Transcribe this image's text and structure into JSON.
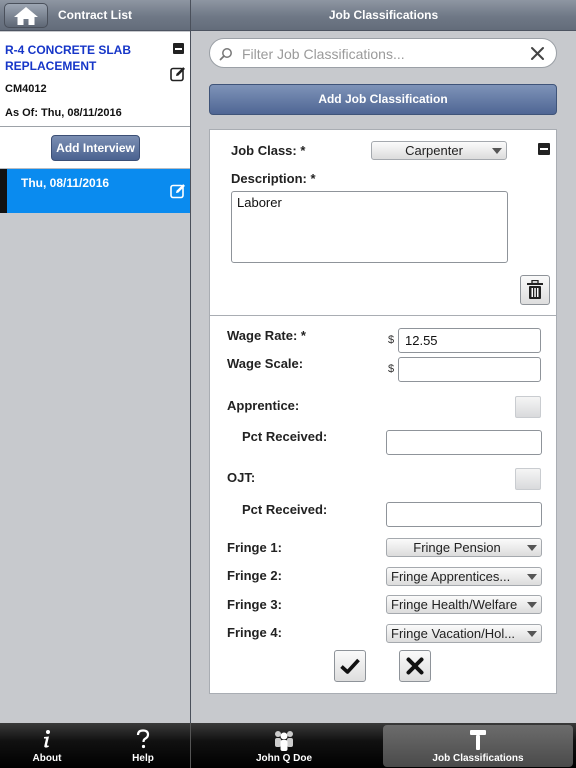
{
  "left_header": {
    "title": "Contract List"
  },
  "right_header": {
    "title": "Job Classifications"
  },
  "contract": {
    "title": "R-4 CONCRETE SLAB REPLACEMENT",
    "number": "CM4012",
    "as_of": "As Of: Thu, 08/11/2016"
  },
  "interview": {
    "add_label": "Add Interview",
    "selected_date": "Thu, 08/11/2016"
  },
  "filter": {
    "placeholder": "Filter Job Classifications..."
  },
  "add_job_label": "Add Job Classification",
  "form": {
    "job_class_label": "Job Class: *",
    "job_class_value": "Carpenter",
    "description_label": "Description: *",
    "description_value": "Laborer",
    "wage_rate_label": "Wage Rate: *",
    "wage_rate_value": "12.55",
    "wage_scale_label": "Wage Scale:",
    "wage_scale_value": "",
    "currency_symbol": "$",
    "apprentice_label": "Apprentice:",
    "pct_received_label": "Pct Received:",
    "apprentice_pct_value": "",
    "ojt_label": "OJT:",
    "ojt_pct_value": "",
    "fringes": [
      {
        "label": "Fringe 1:",
        "value": "Fringe Pension"
      },
      {
        "label": "Fringe 2:",
        "value": "Fringe Apprentices..."
      },
      {
        "label": "Fringe 3:",
        "value": "Fringe Health/Welfare"
      },
      {
        "label": "Fringe 4:",
        "value": "Fringe Vacation/Hol..."
      }
    ]
  },
  "tabs": [
    {
      "label": "About",
      "icon": "info-icon"
    },
    {
      "label": "Help",
      "icon": "question-icon"
    },
    {
      "label": "John Q Doe",
      "icon": "users-icon"
    },
    {
      "label": "Job Classifications",
      "icon": "hammer-icon"
    }
  ],
  "colors": {
    "selected_row": "#0a8bef",
    "contract_title": "#1636c8",
    "button_blue": "#4f6694"
  }
}
